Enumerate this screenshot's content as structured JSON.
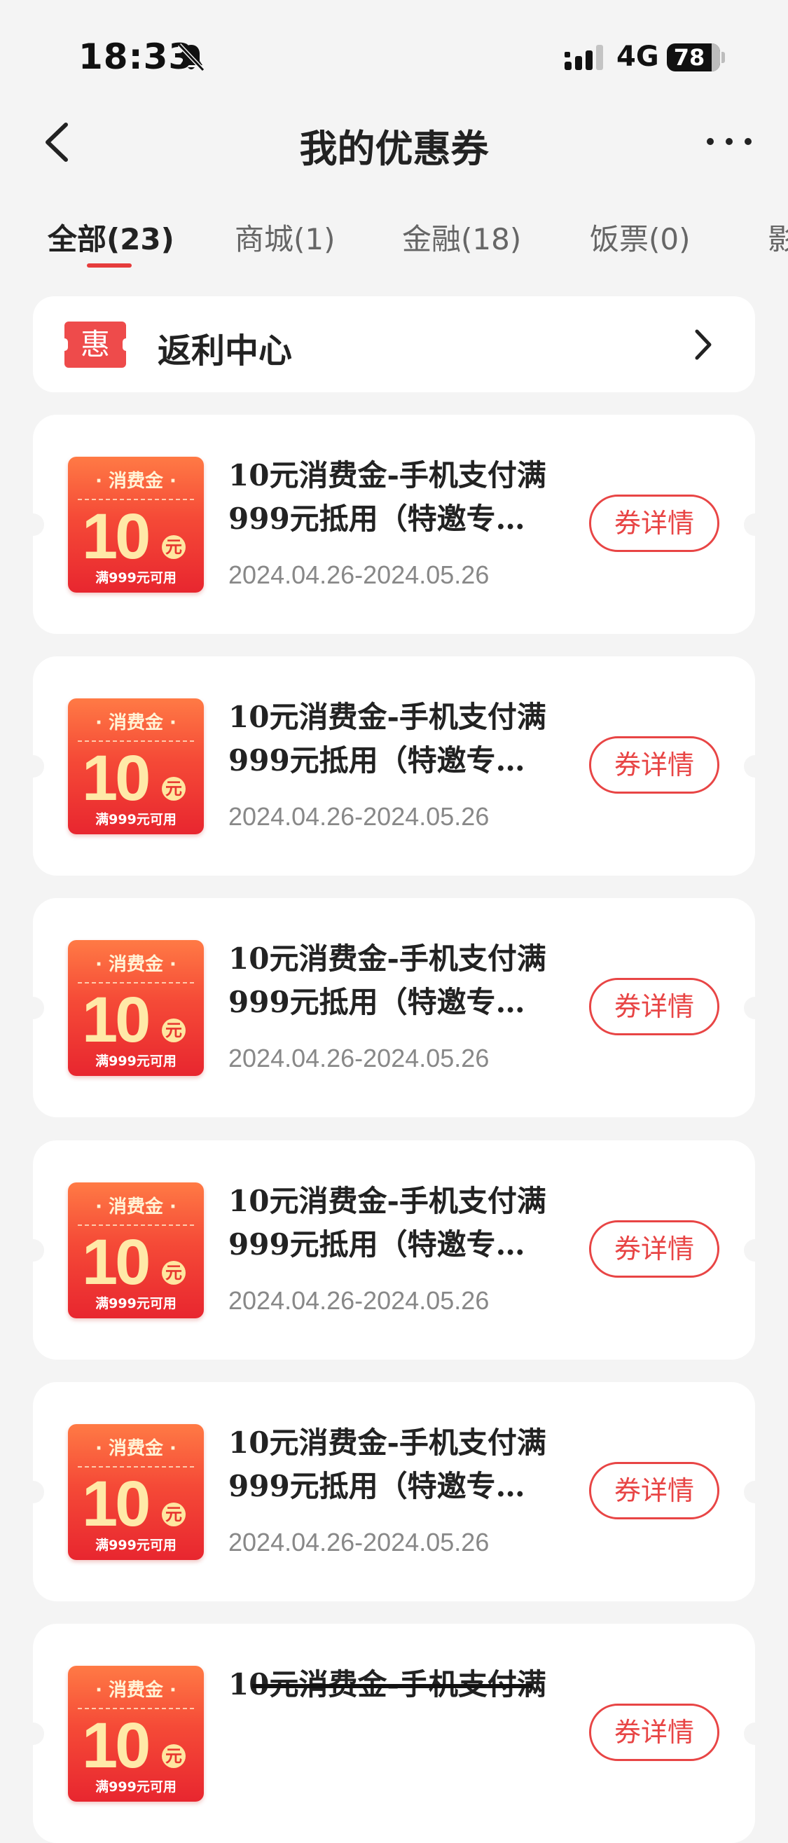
{
  "status_bar": {
    "time": "18:33",
    "network": "4G",
    "battery": "78"
  },
  "header": {
    "title": "我的优惠券"
  },
  "tabs": [
    {
      "label": "全部(23)"
    },
    {
      "label": "商城(1)"
    },
    {
      "label": "金融(18)"
    },
    {
      "label": "饭票(0)"
    },
    {
      "label": "影"
    }
  ],
  "rebate_center": {
    "badge": "惠",
    "label": "返利中心"
  },
  "coupons": [
    {
      "badge_top": "· 消费金 ·",
      "amount": "10",
      "unit": "元",
      "condition": "满999元可用",
      "title": "10元消费金-手机支付满999元抵用（特邀专…",
      "date": "2024.04.26-2024.05.26",
      "button": "券详情"
    },
    {
      "badge_top": "· 消费金 ·",
      "amount": "10",
      "unit": "元",
      "condition": "满999元可用",
      "title": "10元消费金-手机支付满999元抵用（特邀专…",
      "date": "2024.04.26-2024.05.26",
      "button": "券详情"
    },
    {
      "badge_top": "· 消费金 ·",
      "amount": "10",
      "unit": "元",
      "condition": "满999元可用",
      "title": "10元消费金-手机支付满999元抵用（特邀专…",
      "date": "2024.04.26-2024.05.26",
      "button": "券详情"
    },
    {
      "badge_top": "· 消费金 ·",
      "amount": "10",
      "unit": "元",
      "condition": "满999元可用",
      "title": "10元消费金-手机支付满999元抵用（特邀专…",
      "date": "2024.04.26-2024.05.26",
      "button": "券详情"
    },
    {
      "badge_top": "· 消费金 ·",
      "amount": "10",
      "unit": "元",
      "condition": "满999元可用",
      "title": "10元消费金-手机支付满999元抵用（特邀专…",
      "date": "2024.04.26-2024.05.26",
      "button": "券详情"
    },
    {
      "badge_top": "· 消费金 ·",
      "amount": "10",
      "unit": "元",
      "condition": "满999元可用",
      "title": "10元消费金-手机支付满",
      "date": "",
      "button": "券详情"
    }
  ],
  "colors": {
    "accent": "#e84545",
    "background": "#f4f4f4",
    "badge": "#f54a37"
  }
}
